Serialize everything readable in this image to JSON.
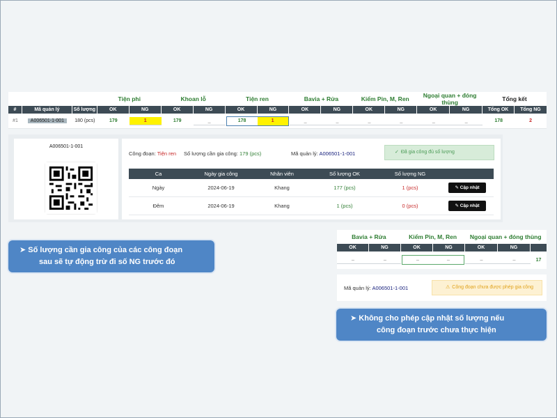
{
  "tracker": {
    "stages": [
      "Tiện phi",
      "Khoan lỗ",
      "Tiện ren",
      "Bavia + Rửa",
      "Kiểm Pin, M, Ren",
      "Ngoại quan + đóng thùng",
      "Tổng kết"
    ],
    "col_index": "#",
    "col_code": "Mã quản lý",
    "col_qty": "Số lượng",
    "ok_label": "OK",
    "ng_label": "NG",
    "total_ok_label": "Tổng OK",
    "total_ng_label": "Tổng NG",
    "row": {
      "index": "#1",
      "code": "A006501-1-001",
      "qty": "180 (pcs)",
      "values": [
        {
          "ok": "179",
          "ng": "1"
        },
        {
          "ok": "179",
          "ng": "_"
        },
        {
          "ok": "178",
          "ng": "1"
        },
        {
          "ok": "_",
          "ng": "_"
        },
        {
          "ok": "_",
          "ng": "_"
        },
        {
          "ok": "_",
          "ng": "_"
        }
      ],
      "total_ok": "178",
      "total_ng": "2"
    }
  },
  "detail": {
    "qr_code_label": "A006501-1-001",
    "stage_label": "Công đoạn:",
    "stage_value": "Tiện ren",
    "qty_needed_label": "Số lượng cần gia công:",
    "qty_needed_value": "179 (pcs)",
    "code_label": "Mã quản lý:",
    "code_value": "A006501-1-001",
    "status_banner": "Đã gia công đủ số lượng",
    "columns": [
      "Ca",
      "Ngày gia công",
      "Nhân viên",
      "Số lượng OK",
      "Số lượng NG"
    ],
    "rows": [
      {
        "shift": "Ngày",
        "date": "2024-06-19",
        "staff": "Khang",
        "ok": "177 (pcs)",
        "ng": "1 (pcs)"
      },
      {
        "shift": "Đêm",
        "date": "2024-06-19",
        "staff": "Khang",
        "ok": "1 (pcs)",
        "ng": "0 (pcs)"
      }
    ],
    "update_label": "Cập nhật"
  },
  "callout1": {
    "line1": "Số lượng cần gia công của các công đoạn",
    "line2": "sau sẽ tự động trừ đi số NG trước đó"
  },
  "tracker2": {
    "stages": [
      "Bavia + Rửa",
      "Kiểm Pin, M, Ren",
      "Ngoại quan + đóng thùng"
    ],
    "ok_label": "OK",
    "ng_label": "NG",
    "values": [
      "_",
      "_",
      "_",
      "_",
      "_",
      "_",
      "17"
    ]
  },
  "detail2": {
    "code_label": "Mã quản lý:",
    "code_value": "A006501-1-001",
    "warning": "Công đoạn chưa được phép gia công"
  },
  "callout2": {
    "line1": "Không cho phép cập nhật số lượng nếu",
    "line2": "công đoạn trước chưa thực hiện"
  },
  "colors": {
    "header_bg": "#3d4b55",
    "ok_green": "#2e7d32",
    "ng_red": "#c62828",
    "highlight_yellow": "#fff200",
    "callout_blue": "#4f86c6"
  }
}
